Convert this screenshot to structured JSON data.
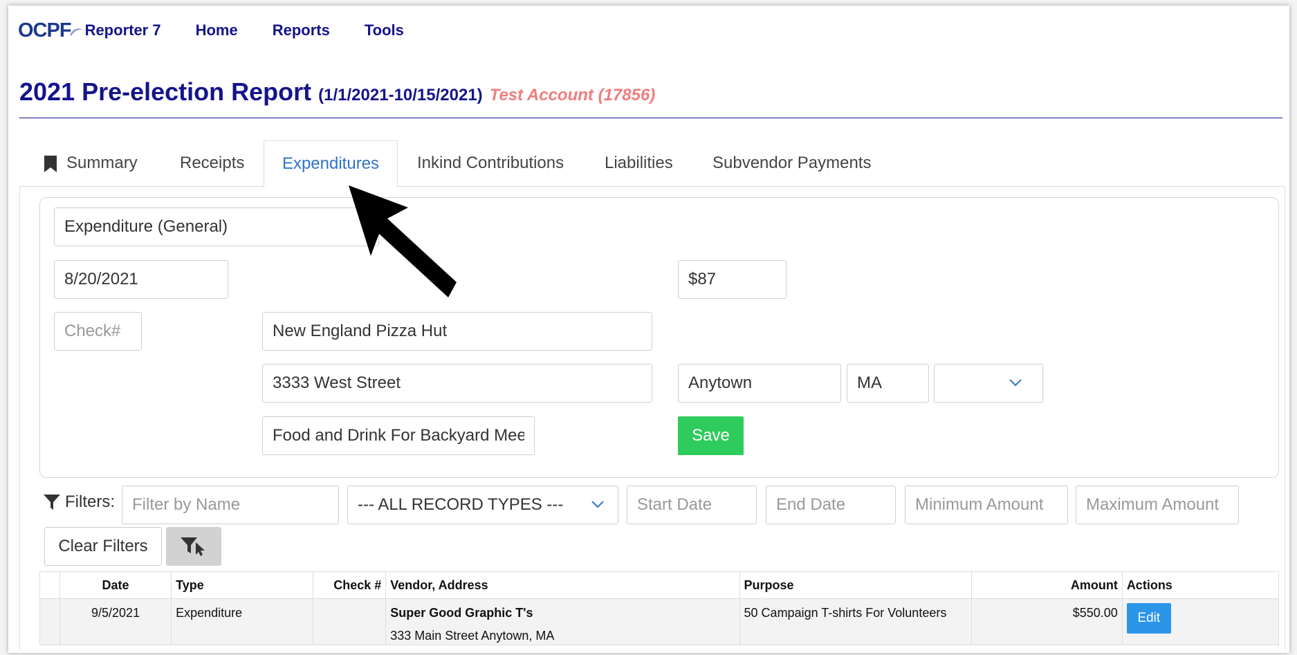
{
  "nav": {
    "logo_text": "OCPF",
    "brand": "Reporter 7",
    "links": [
      "Home",
      "Reports",
      "Tools"
    ]
  },
  "report": {
    "title": "2021 Pre-election Report",
    "date_range": "(1/1/2021-10/15/2021)",
    "account": "Test Account (17856)"
  },
  "tabs": [
    {
      "label": "Summary"
    },
    {
      "label": "Receipts"
    },
    {
      "label": "Expenditures",
      "active": true
    },
    {
      "label": "Inkind Contributions"
    },
    {
      "label": "Liabilities"
    },
    {
      "label": "Subvendor Payments"
    }
  ],
  "form": {
    "type": "Expenditure (General)",
    "date": "8/20/2021",
    "amount": "$87",
    "check_placeholder": "Check#",
    "vendor": "New England Pizza Hut",
    "street": "3333 West Street",
    "city": "Anytown",
    "state": "MA",
    "zip": "",
    "purpose": "Food and Drink For Backyard Mee",
    "save_label": "Save"
  },
  "filters": {
    "label": "Filters:",
    "name_placeholder": "Filter by Name",
    "record_type": "--- ALL RECORD TYPES ---",
    "start_placeholder": "Start Date",
    "end_placeholder": "End Date",
    "min_placeholder": "Minimum Amount",
    "max_placeholder": "Maximum Amount",
    "clear_label": "Clear Filters"
  },
  "table": {
    "headers": {
      "date": "Date",
      "type": "Type",
      "check": "Check #",
      "vendor": "Vendor, Address",
      "purpose": "Purpose",
      "amount": "Amount",
      "actions": "Actions"
    },
    "rows": [
      {
        "date": "9/5/2021",
        "type": "Expenditure",
        "check": "",
        "vendor_name": "Super Good Graphic T's",
        "vendor_address": "333 Main Street Anytown, MA",
        "purpose": "50 Campaign T-shirts For Volunteers",
        "amount": "$550.00",
        "action_label": "Edit"
      }
    ]
  },
  "colors": {
    "navy": "#14148c",
    "account_red": "#ef7e7e",
    "tab_active": "#2f73c8",
    "save_green": "#2ecc5c",
    "edit_blue": "#2b95e8"
  }
}
